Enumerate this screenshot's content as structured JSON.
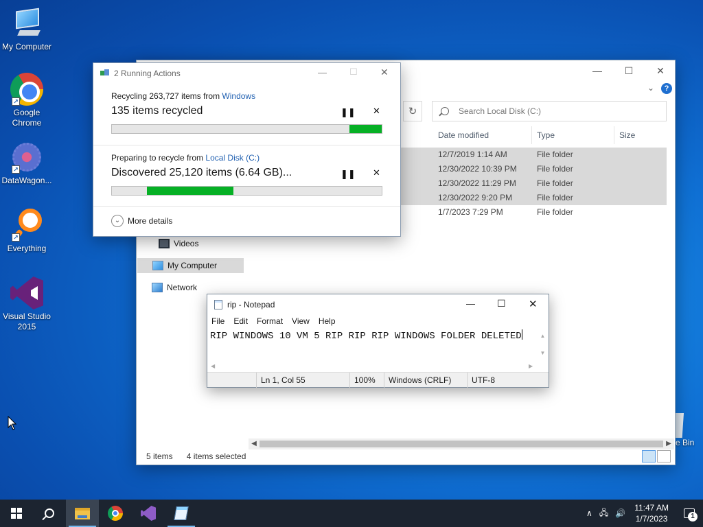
{
  "desktop": {
    "icons": [
      {
        "label": "My Computer",
        "icon": "computer-icon"
      },
      {
        "label": "Google Chrome",
        "icon": "chrome-icon"
      },
      {
        "label": "DataWagon...",
        "icon": "datawagon-icon"
      },
      {
        "label": "Everything",
        "icon": "everything-search-icon"
      },
      {
        "label": "Visual Studio 2015",
        "icon": "visual-studio-icon"
      }
    ],
    "recycle_bin_partial_label": "e Bin"
  },
  "explorer": {
    "search_placeholder": "Search Local Disk (C:)",
    "columns": [
      "Date modified",
      "Type",
      "Size"
    ],
    "rows": [
      {
        "date": "12/7/2019 1:14 AM",
        "type": "File folder",
        "selected": true
      },
      {
        "date": "12/30/2022 10:39 PM",
        "type": "File folder",
        "selected": true
      },
      {
        "date": "12/30/2022 11:29 PM",
        "type": "File folder",
        "selected": true
      },
      {
        "date": "12/30/2022 9:20 PM",
        "type": "File folder",
        "selected": true
      },
      {
        "date": "1/7/2023 7:29 PM",
        "type": "File folder",
        "selected": false
      }
    ],
    "nav": {
      "videos": "Videos",
      "my_computer": "My Computer",
      "network": "Network"
    },
    "status": {
      "items": "5 items",
      "selected": "4 items selected"
    }
  },
  "actions_dialog": {
    "title": "2 Running Actions",
    "task1": {
      "prefix": "Recycling 263,727 items from ",
      "source": "Windows",
      "status": "135 items recycled",
      "progress": 0.12
    },
    "task2": {
      "prefix": "Preparing to recycle from ",
      "source": "Local Disk (C:)",
      "status": "Discovered 25,120 items (6.64 GB)...",
      "progress_start": 0.13,
      "progress_end": 0.45
    },
    "more_details": "More details"
  },
  "notepad": {
    "title": "rip - Notepad",
    "menu": [
      "File",
      "Edit",
      "Format",
      "View",
      "Help"
    ],
    "text": "RIP WINDOWS 10 VM 5 RIP RIP RIP WINDOWS FOLDER DELETED",
    "status": {
      "position": "Ln 1, Col 55",
      "zoom": "100%",
      "line_ending": "Windows (CRLF)",
      "encoding": "UTF-8"
    }
  },
  "taskbar": {
    "clock_time": "11:47 AM",
    "clock_date": "1/7/2023",
    "notification_count": "1",
    "apps": [
      "file-explorer-icon",
      "chrome-icon",
      "visual-studio-icon",
      "notepad-icon"
    ]
  },
  "colors": {
    "progress_green": "#06b025",
    "link_blue": "#1f5fb0",
    "desktop_blue": "#0f6fd3",
    "taskbar": "#1c2430"
  }
}
